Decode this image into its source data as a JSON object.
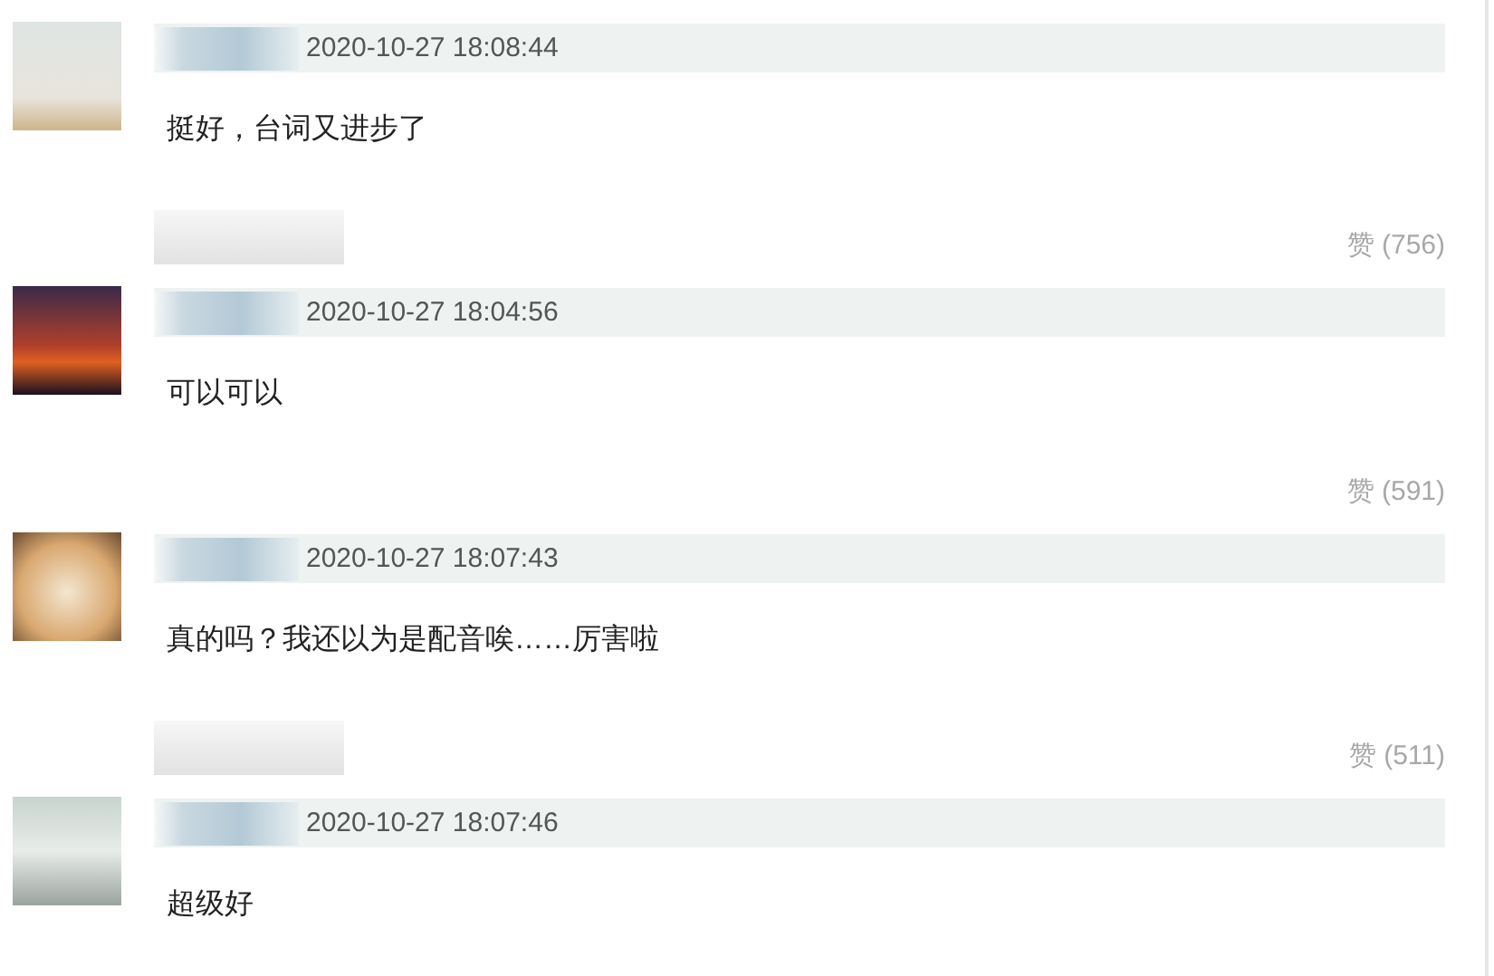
{
  "comments": [
    {
      "time": "2020-10-27 18:08:44",
      "text": "挺好，台词又进步了",
      "footer_redacted": true,
      "likes": "赞 (756)"
    },
    {
      "time": "2020-10-27 18:04:56",
      "text": "可以可以",
      "footer_redacted": false,
      "likes": "赞 (591)"
    },
    {
      "time": "2020-10-27 18:07:43",
      "text": "真的吗？我还以为是配音唉……厉害啦",
      "footer_redacted": true,
      "likes": "赞 (511)"
    },
    {
      "time": "2020-10-27 18:07:46",
      "text": "超级好",
      "footer_redacted": false
    }
  ]
}
